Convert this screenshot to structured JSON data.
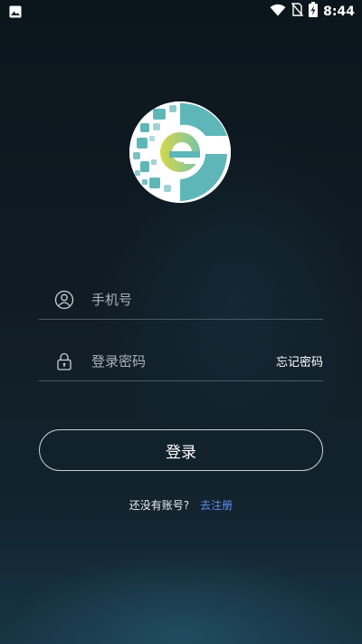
{
  "status_bar": {
    "time": "8:44",
    "icons": [
      "image-icon",
      "wifi-icon",
      "no-sim-icon",
      "battery-charging-icon"
    ]
  },
  "logo": {
    "icon": "e-logo-icon",
    "colors": {
      "teal": "#5fb6b8",
      "lime": "#bfd34a"
    }
  },
  "login_form": {
    "phone": {
      "placeholder": "手机号",
      "value": "",
      "icon": "user-icon"
    },
    "password": {
      "placeholder": "登录密码",
      "value": "",
      "icon": "lock-icon"
    },
    "forgot_password": "忘记密码",
    "submit_label": "登录"
  },
  "register": {
    "prompt": "还没有账号?",
    "link": "去注册"
  },
  "colors": {
    "link": "#5b8ff0",
    "background": "#101c24"
  }
}
